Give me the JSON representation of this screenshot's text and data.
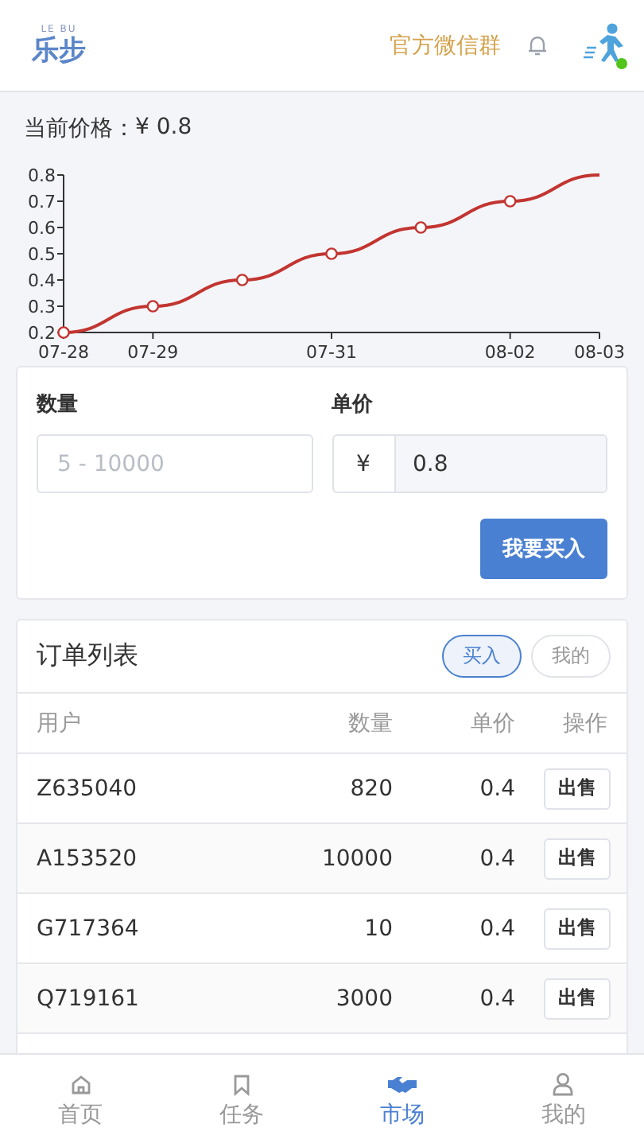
{
  "header": {
    "logo_small": "LE BU",
    "logo": "乐步",
    "link": "官方微信群"
  },
  "price": {
    "label": "当前价格：",
    "value": "¥ 0.8"
  },
  "chart_data": {
    "type": "line",
    "categories": [
      "07-28",
      "07-29",
      null,
      "07-31",
      null,
      "08-02",
      "08-03"
    ],
    "ylim": [
      0.2,
      0.8
    ],
    "yticks": [
      0.2,
      0.3,
      0.4,
      0.5,
      0.6,
      0.7,
      0.8
    ],
    "series": [
      {
        "color": "#c23531",
        "marker": "circle",
        "values": [
          0.2,
          0.3,
          0.4,
          0.5,
          0.6,
          0.7,
          0.8
        ]
      }
    ]
  },
  "buy_form": {
    "quantity_label": "数量",
    "quantity_placeholder": "5 - 10000",
    "price_label": "单价",
    "currency": "¥",
    "price_value": "0.8",
    "button": "我要买入"
  },
  "orders": {
    "title": "订单列表",
    "filters": [
      {
        "label": "买入",
        "selected": true
      },
      {
        "label": "我的",
        "selected": false
      }
    ],
    "columns": [
      "用户",
      "数量",
      "单价",
      "操作"
    ],
    "rows": [
      {
        "user": "Z635040",
        "quantity": "820",
        "price": "0.4",
        "action": "出售"
      },
      {
        "user": "A153520",
        "quantity": "10000",
        "price": "0.4",
        "action": "出售"
      },
      {
        "user": "G717364",
        "quantity": "10",
        "price": "0.4",
        "action": "出售"
      },
      {
        "user": "Q719161",
        "quantity": "3000",
        "price": "0.4",
        "action": "出售"
      }
    ]
  },
  "tabbar": [
    {
      "kind": "home",
      "label": "首页",
      "selected": false
    },
    {
      "kind": "bookmark",
      "label": "任务",
      "selected": false
    },
    {
      "kind": "handshake",
      "label": "市场",
      "selected": true
    },
    {
      "kind": "user",
      "label": "我的",
      "selected": false
    }
  ]
}
